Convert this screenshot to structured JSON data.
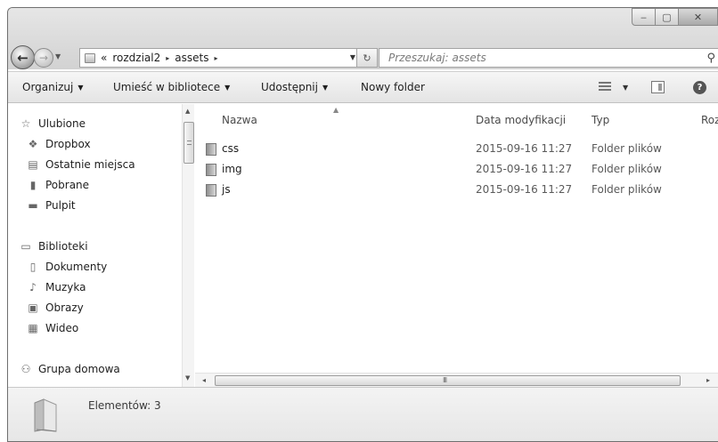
{
  "window": {
    "controls": {
      "minimize": "‒",
      "maximize": "▢",
      "close": "✕"
    }
  },
  "address": {
    "prefix": "«",
    "crumbs": [
      "rozdzial2",
      "assets"
    ],
    "separator": "▸"
  },
  "search": {
    "placeholder": "Przeszukaj: assets"
  },
  "toolbar": {
    "organize": "Organizuj",
    "include_library": "Umieść w bibliotece",
    "share": "Udostępnij",
    "new_folder": "Nowy folder"
  },
  "nav": {
    "favorites": "Ulubione",
    "dropbox": "Dropbox",
    "recent_places": "Ostatnie miejsca",
    "downloads": "Pobrane",
    "desktop": "Pulpit",
    "libraries": "Biblioteki",
    "documents": "Dokumenty",
    "music": "Muzyka",
    "pictures": "Obrazy",
    "videos": "Wideo",
    "homegroup": "Grupa domowa"
  },
  "columns": {
    "name": "Nazwa",
    "date_modified": "Data modyfikacji",
    "type": "Typ",
    "size": "Roz"
  },
  "files": [
    {
      "name": "css",
      "date": "2015-09-16 11:27",
      "type": "Folder plików"
    },
    {
      "name": "img",
      "date": "2015-09-16 11:27",
      "type": "Folder plików"
    },
    {
      "name": "js",
      "date": "2015-09-16 11:27",
      "type": "Folder plików"
    }
  ],
  "details": {
    "item_count": "Elementów: 3"
  }
}
